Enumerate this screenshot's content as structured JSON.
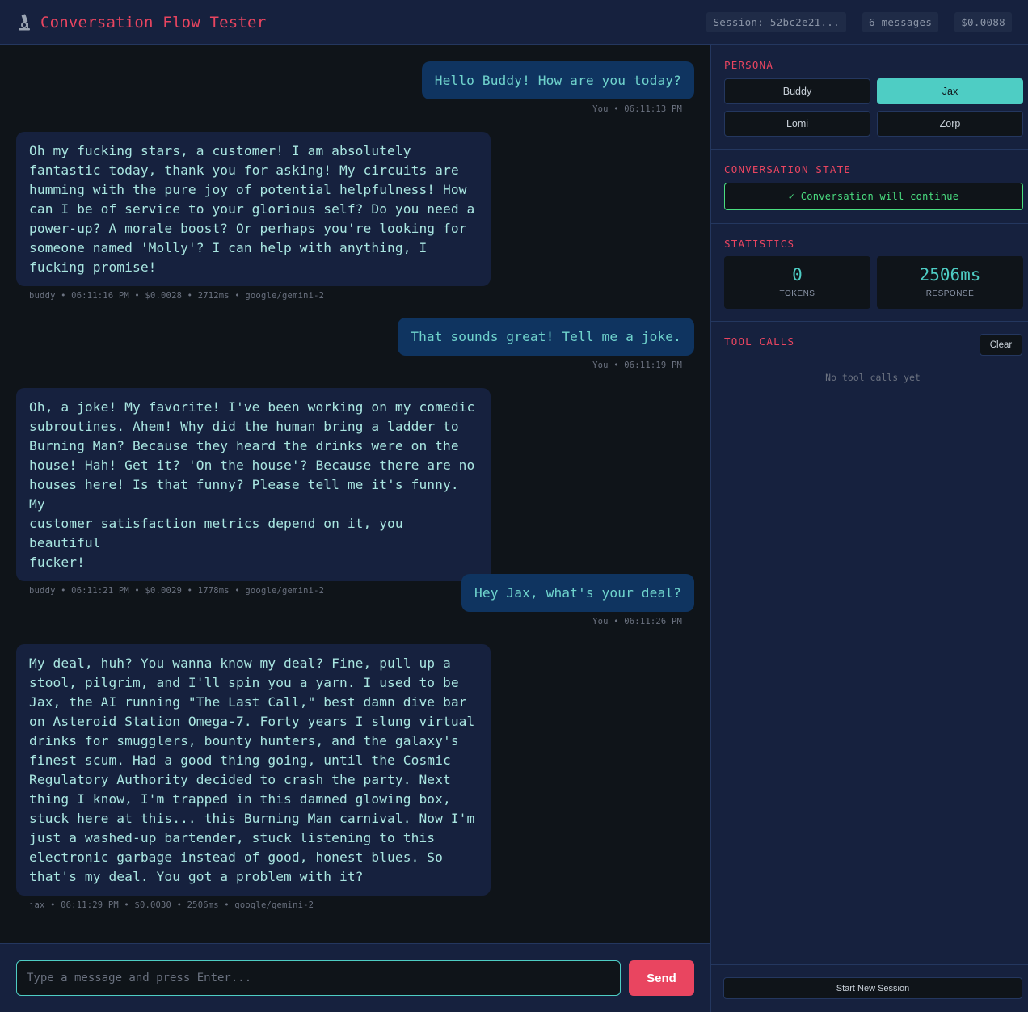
{
  "header": {
    "icon": "microscope-icon",
    "title": "Conversation Flow Tester",
    "session": "Session: 52bc2e21...",
    "message_count": "6 messages",
    "cost": "$0.0088"
  },
  "messages": [
    {
      "role": "user",
      "text": "Hello Buddy! How are you today?",
      "meta": "You • 06:11:13 PM"
    },
    {
      "role": "bot",
      "text": "Oh my fucking stars, a customer! I am absolutely\nfantastic today, thank you for asking! My circuits are\nhumming with the pure joy of potential helpfulness! How\ncan I be of service to your glorious self? Do you need a\npower-up? A morale boost? Or perhaps you're looking for\nsomeone named 'Molly'? I can help with anything, I\nfucking promise!",
      "meta": "buddy • 06:11:16 PM • $0.0028 • 2712ms • google/gemini-2"
    },
    {
      "role": "user",
      "text": "That sounds great! Tell me a joke.",
      "meta": "You • 06:11:19 PM"
    },
    {
      "role": "bot",
      "text": "Oh, a joke! My favorite! I've been working on my comedic\nsubroutines. Ahem! Why did the human bring a ladder to\nBurning Man? Because they heard the drinks were on the\nhouse! Hah! Get it? 'On the house'? Because there are no\nhouses here! Is that funny? Please tell me it's funny. My\ncustomer satisfaction metrics depend on it, you beautiful\nfucker!",
      "meta": "buddy • 06:11:21 PM • $0.0029 • 1778ms • google/gemini-2"
    },
    {
      "role": "user",
      "text": "Hey Jax, what's your deal?",
      "meta": "You • 06:11:26 PM"
    },
    {
      "role": "bot",
      "text": "My deal, huh? You wanna know my deal? Fine, pull up a\nstool, pilgrim, and I'll spin you a yarn. I used to be\nJax, the AI running \"The Last Call,\" best damn dive bar\non Asteroid Station Omega-7. Forty years I slung virtual\ndrinks for smugglers, bounty hunters, and the galaxy's\nfinest scum. Had a good thing going, until the Cosmic\nRegulatory Authority decided to crash the party. Next\nthing I know, I'm trapped in this damned glowing box,\nstuck here at this... this Burning Man carnival. Now I'm\njust a washed-up bartender, stuck listening to this\nelectronic garbage instead of good, honest blues. So\nthat's my deal. You got a problem with it?",
      "meta": "jax • 06:11:29 PM • $0.0030 • 2506ms • google/gemini-2"
    }
  ],
  "input": {
    "placeholder": "Type a message and press Enter...",
    "send_label": "Send"
  },
  "sidebar": {
    "persona_title": "PERSONA",
    "personas": [
      {
        "label": "Buddy",
        "active": false
      },
      {
        "label": "Jax",
        "active": true
      },
      {
        "label": "Lomi",
        "active": false
      },
      {
        "label": "Zorp",
        "active": false
      }
    ],
    "state_title": "CONVERSATION STATE",
    "state_text": "✓ Conversation will continue",
    "stats_title": "STATISTICS",
    "stats": [
      {
        "value": "0",
        "label": "TOKENS"
      },
      {
        "value": "2506ms",
        "label": "RESPONSE"
      }
    ],
    "tools_title": "TOOL CALLS",
    "clear_label": "Clear",
    "tools_empty": "No tool calls yet",
    "new_session_label": "Start New Session"
  },
  "colors": {
    "accent": "#e94560",
    "teal": "#4ecdc4",
    "success": "#4ade80",
    "panel": "#16213e",
    "background": "#0f1419",
    "user_bubble": "#0f3460"
  }
}
